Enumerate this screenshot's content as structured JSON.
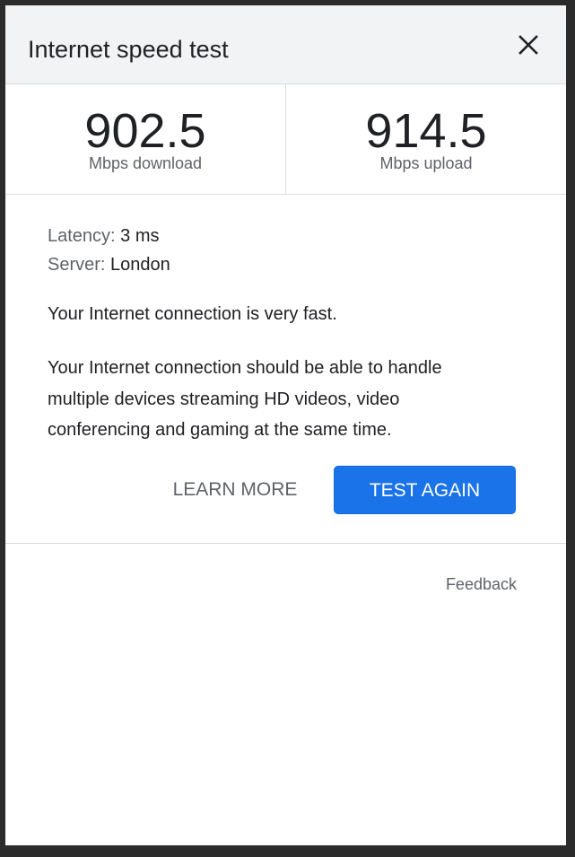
{
  "header": {
    "title": "Internet speed test",
    "close_icon": "close-icon"
  },
  "speeds": {
    "download": {
      "value": "902.5",
      "unit": "Mbps download"
    },
    "upload": {
      "value": "914.5",
      "unit": "Mbps upload"
    }
  },
  "details": {
    "latency_label": "Latency:",
    "latency_value": "3 ms",
    "server_label": "Server:",
    "server_value": "London"
  },
  "status_text": "Your Internet connection is very fast.",
  "description_text": "Your Internet connection should be able to handle multiple devices streaming HD videos, video conferencing and gaming at the same time.",
  "actions": {
    "learn_more_label": "LEARN MORE",
    "test_again_label": "TEST AGAIN"
  },
  "footer": {
    "feedback_label": "Feedback"
  },
  "colors": {
    "primary": "#1a73e8",
    "header_bg": "#f1f3f4",
    "text": "#202124",
    "secondary_text": "#5f6368",
    "divider": "#dadce0"
  }
}
